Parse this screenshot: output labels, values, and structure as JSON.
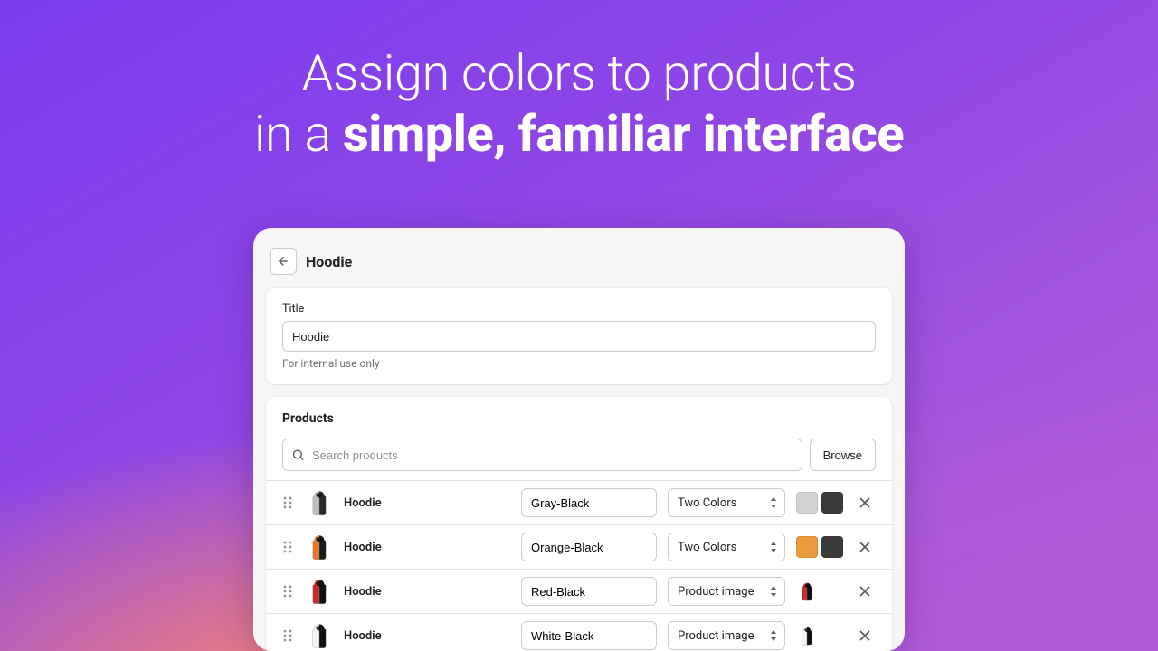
{
  "headline": {
    "line1": "Assign colors to products",
    "line2_prefix": "in a ",
    "line2_bold": "simple, familiar interface"
  },
  "page": {
    "title": "Hoodie"
  },
  "title_card": {
    "label": "Title",
    "value": "Hoodie",
    "helper": "For internal use only"
  },
  "products_card": {
    "heading": "Products",
    "search_placeholder": "Search products",
    "browse_label": "Browse"
  },
  "rows": [
    {
      "name": "Hoodie",
      "variant": "Gray-Black",
      "mode": "Two Colors",
      "swatches": [
        "#d3d3d3",
        "#3a3a3a"
      ],
      "thumb_colors": {
        "left": "#bdbdbd",
        "right": "#2b2b2b"
      }
    },
    {
      "name": "Hoodie",
      "variant": "Orange-Black",
      "mode": "Two Colors",
      "swatches": [
        "#e89a3c",
        "#3a3a3a"
      ],
      "thumb_colors": {
        "left": "#e6772e",
        "right": "#1a1a1a"
      }
    },
    {
      "name": "Hoodie",
      "variant": "Red-Black",
      "mode": "Product image",
      "mini_thumb_colors": {
        "left": "#c92a2a",
        "right": "#111111"
      },
      "thumb_colors": {
        "left": "#c92a2a",
        "right": "#111111"
      }
    },
    {
      "name": "Hoodie",
      "variant": "White-Black",
      "mode": "Product image",
      "mini_thumb_colors": {
        "left": "#f4f4f4",
        "right": "#111111"
      },
      "thumb_colors": {
        "left": "#f4f4f4",
        "right": "#111111"
      }
    }
  ]
}
